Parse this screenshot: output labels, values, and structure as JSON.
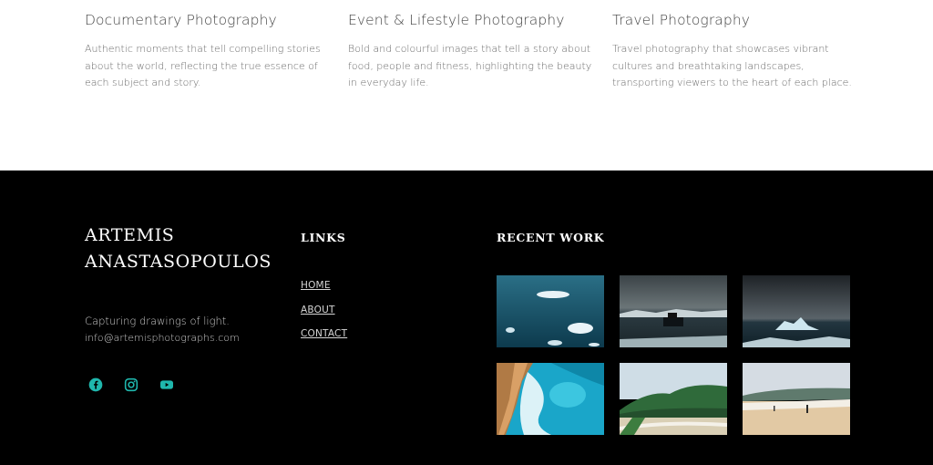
{
  "services": [
    {
      "title": "Documentary Photography",
      "description": "Authentic moments that tell compelling stories about the world, reflecting the true essence of each subject and story."
    },
    {
      "title": "Event & Lifestyle Photography",
      "description": "Bold and colourful images that tell a story about food, people and fitness, highlighting the beauty in everyday life."
    },
    {
      "title": "Travel Photography",
      "description": "Travel photography that showcases vibrant cultures and breathtaking landscapes, transporting viewers to the heart of each place."
    }
  ],
  "footer": {
    "brand_line1": "ARTEMIS",
    "brand_line2": "ANASTASOPOULOS",
    "tagline": "Capturing drawings of light.",
    "email": "info@artemisphotographs.com",
    "social_icons": [
      "facebook-icon",
      "instagram-icon",
      "youtube-icon"
    ],
    "social_color": "#1fb7ad",
    "links_heading": "LINKS",
    "links": [
      "HOME",
      "ABOUT",
      "CONTACT"
    ],
    "recent_heading": "RECENT WORK",
    "recent_work": [
      "ice-floes-aerial-photo",
      "boat-among-icebergs-photo",
      "iceberg-storm-sky-photo",
      "coastal-rock-pool-aerial-photo",
      "green-hills-coast-road-photo",
      "beach-walker-photo"
    ]
  }
}
